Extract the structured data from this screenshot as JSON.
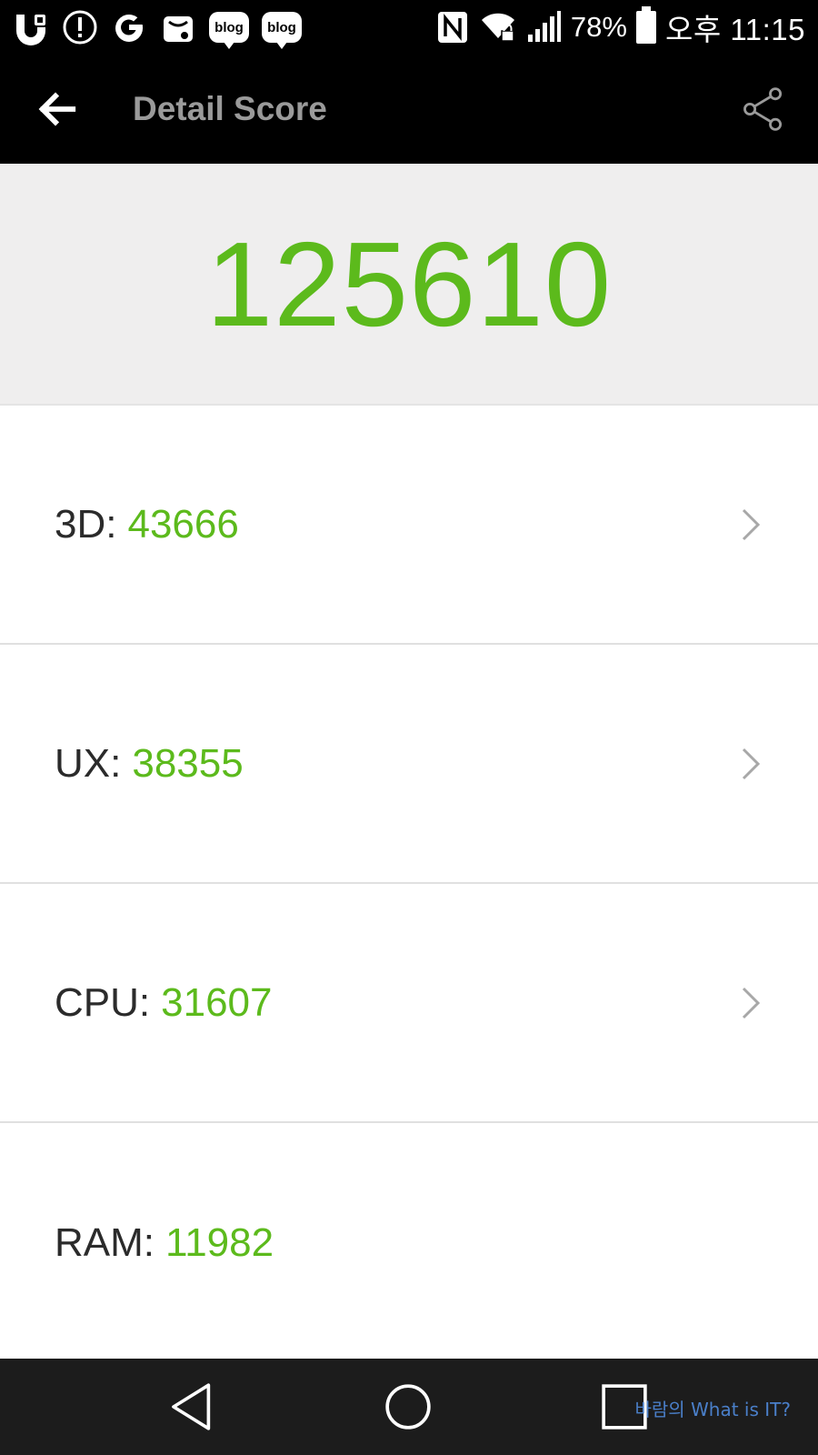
{
  "status_bar": {
    "blog_badge_1": "blog",
    "blog_badge_2": "blog",
    "battery": "78%",
    "clock": "오후 11:15"
  },
  "app_bar": {
    "title": "Detail Score"
  },
  "total": {
    "score": "125610"
  },
  "scores": [
    {
      "label": "3D:",
      "value": "43666"
    },
    {
      "label": "UX:",
      "value": "38355"
    },
    {
      "label": "CPU:",
      "value": "31607"
    },
    {
      "label": "RAM:",
      "value": "11982"
    }
  ],
  "watermark": "바람의 What is IT?",
  "colors": {
    "accent_green": "#5cba1c",
    "bar_black": "#000000",
    "panel_gray": "#efeeee"
  }
}
